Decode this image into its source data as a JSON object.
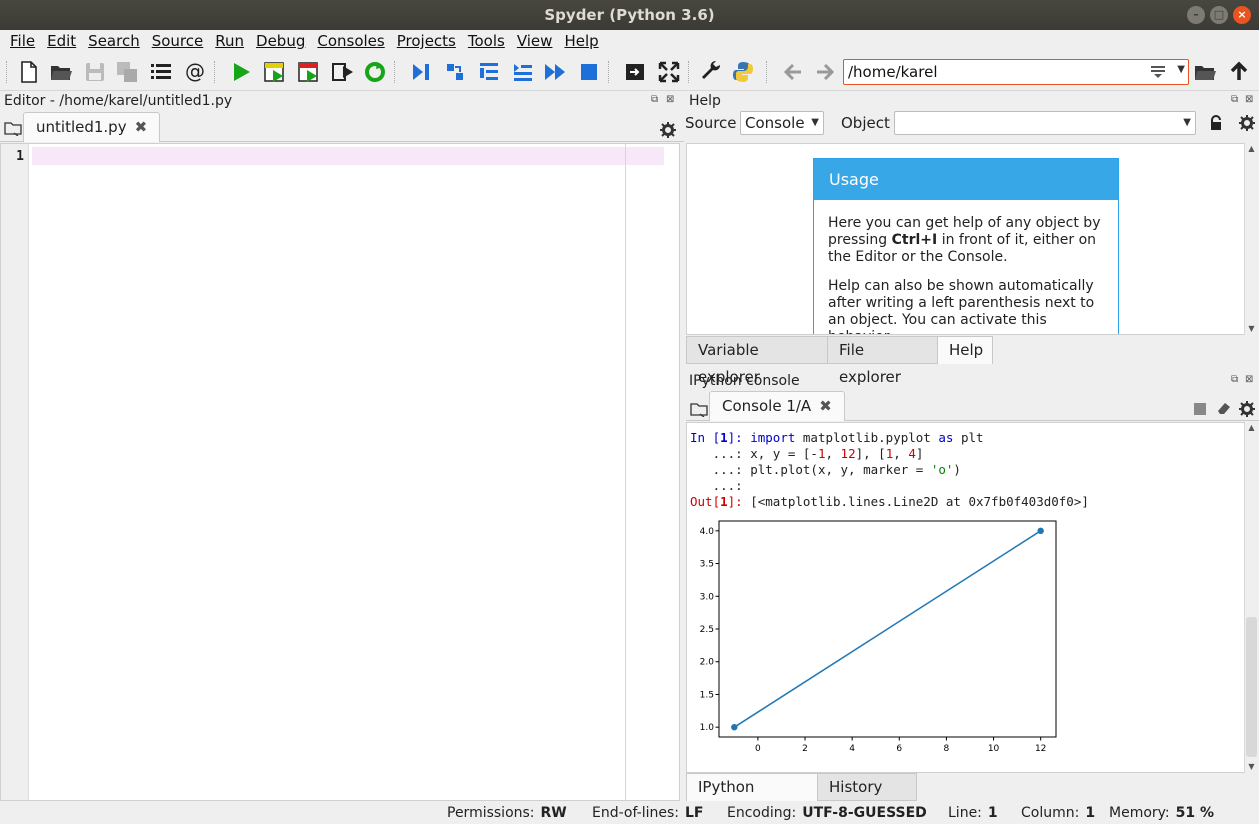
{
  "window": {
    "title": "Spyder (Python 3.6)"
  },
  "menu": [
    "File",
    "Edit",
    "Search",
    "Source",
    "Run",
    "Debug",
    "Consoles",
    "Projects",
    "Tools",
    "View",
    "Help"
  ],
  "toolbar": {
    "path": "/home/karel"
  },
  "editor": {
    "title": "Editor - /home/karel/untitled1.py",
    "tab": "untitled1.py",
    "line_number": "1"
  },
  "help": {
    "title": "Help",
    "source_label": "Source",
    "source_value": "Console",
    "object_label": "Object",
    "object_value": "",
    "usage_title": "Usage",
    "usage_p1_a": "Here you can get help of any object by pressing ",
    "usage_p1_bold": "Ctrl+I",
    "usage_p1_b": " in front of it, either on the Editor or the Console.",
    "usage_p2": "Help can also be shown automatically after writing a left parenthesis next to an object. You can activate this behavior",
    "tabs": [
      "Variable explorer",
      "File explorer",
      "Help"
    ]
  },
  "console": {
    "title": "IPython console",
    "tab": "Console 1/A",
    "lines": {
      "in_prompt": "In [",
      "in_num": "1",
      "prompt_end": "]: ",
      "l1_kw1": "import",
      "l1_mid": " matplotlib.pyplot ",
      "l1_kw2": "as",
      "l1_end": " plt",
      "cont": "   ...: ",
      "l2_a": "x, y = [-",
      "l2_n1": "1",
      "l2_b": ", ",
      "l2_n2": "12",
      "l2_c": "], [",
      "l2_n3": "1",
      "l2_d": ", ",
      "l2_n4": "4",
      "l2_e": "]",
      "l3_a": "plt.plot(x, y, marker = ",
      "l3_s": "'o'",
      "l3_b": ")",
      "l4": "   ...:",
      "out_prompt": "Out[",
      "out_text": "[<matplotlib.lines.Line2D at 0x7fb0f403d0f0>]"
    },
    "tabs": [
      "IPython console",
      "History log"
    ]
  },
  "chart_data": {
    "type": "line",
    "x": [
      -1,
      12
    ],
    "y": [
      1,
      4
    ],
    "marker": "o",
    "color": "#1f77b4",
    "xticks": [
      "0",
      "2",
      "4",
      "6",
      "8",
      "10",
      "12"
    ],
    "yticks": [
      "1.0",
      "1.5",
      "2.0",
      "2.5",
      "3.0",
      "3.5",
      "4.0"
    ],
    "xlim": [
      -1.65,
      12.65
    ],
    "ylim": [
      0.85,
      4.15
    ]
  },
  "status": {
    "permissions_label": "Permissions:",
    "permissions": "RW",
    "eol_label": "End-of-lines:",
    "eol": "LF",
    "encoding_label": "Encoding:",
    "encoding": "UTF-8-GUESSED",
    "line_label": "Line:",
    "line": "1",
    "column_label": "Column:",
    "column": "1",
    "memory_label": "Memory:",
    "memory": "51 %"
  }
}
